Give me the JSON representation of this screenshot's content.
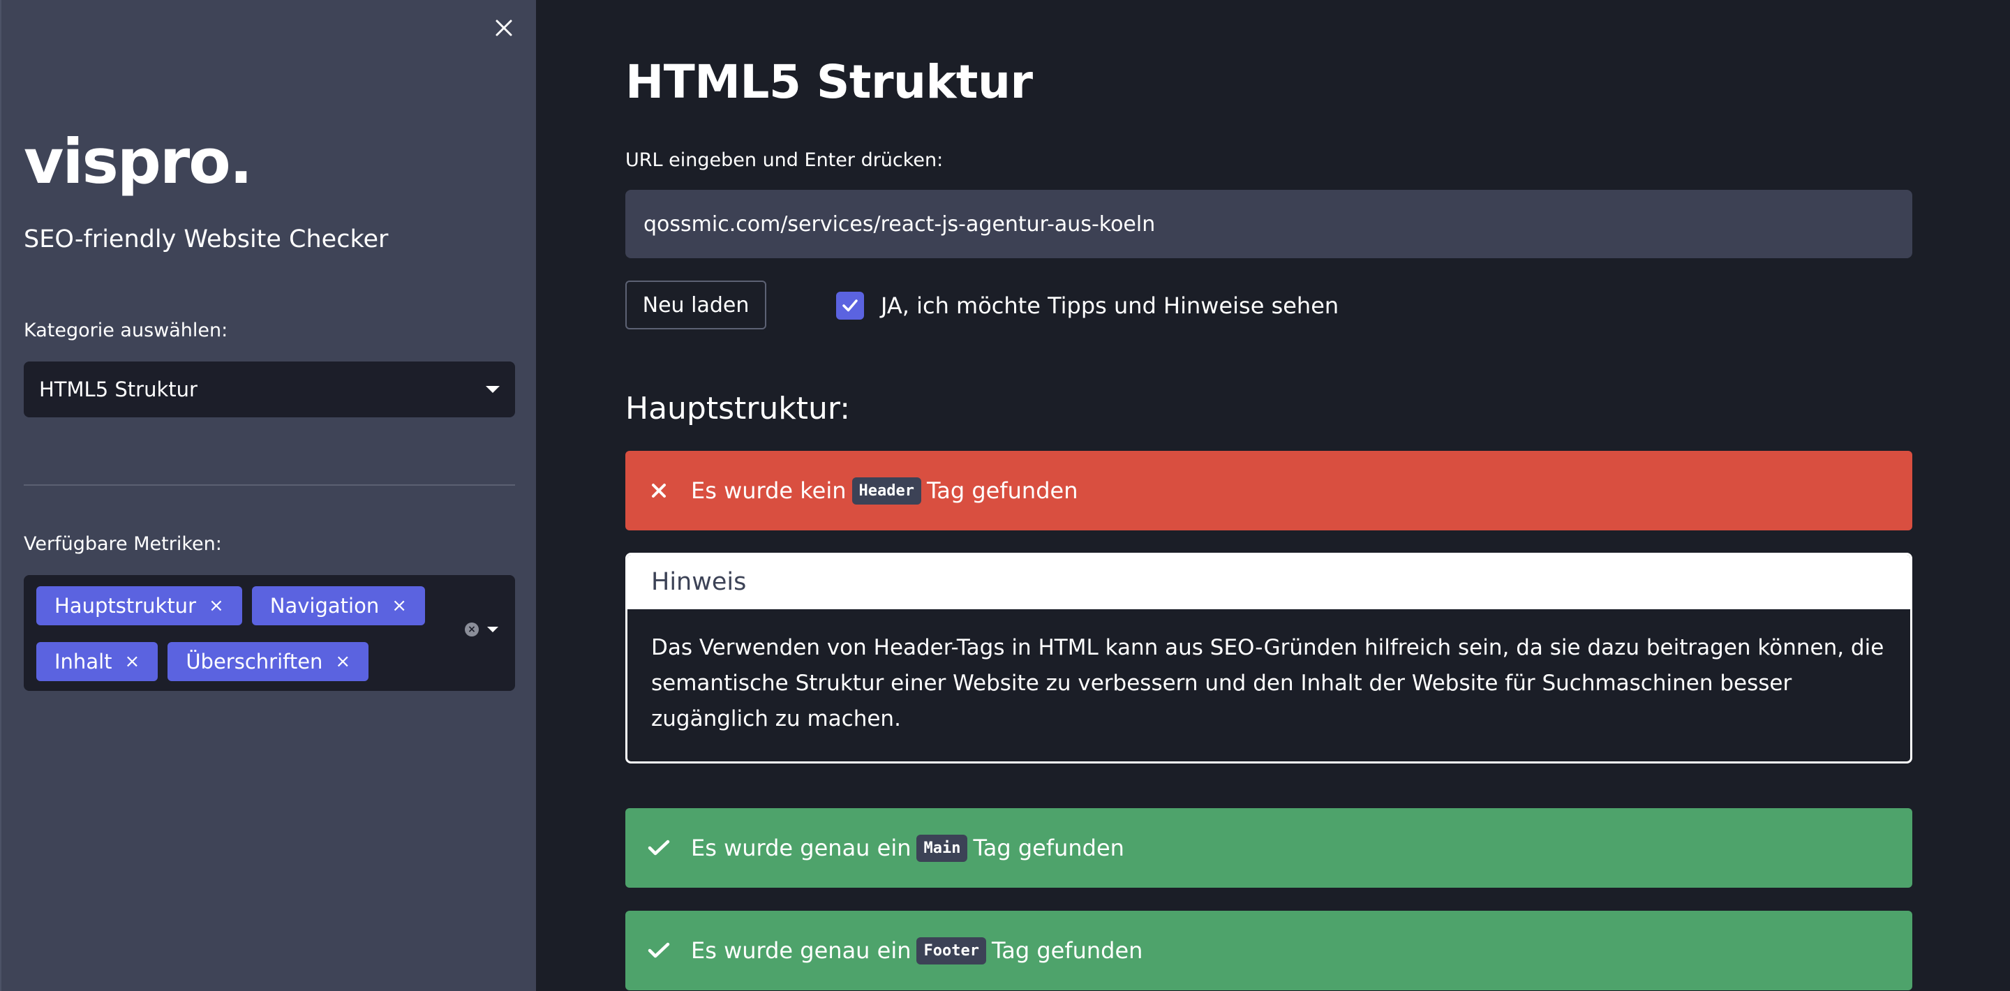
{
  "sidebar": {
    "close_icon": "close-icon",
    "brand": "vispro.",
    "tagline": "SEO-friendly Website Checker",
    "category_label": "Kategorie auswählen:",
    "category_value": "HTML5 Struktur",
    "metrics_label": "Verfügbare Metriken:",
    "metrics": [
      {
        "label": "Hauptstruktur"
      },
      {
        "label": "Navigation"
      },
      {
        "label": "Inhalt"
      },
      {
        "label": "Überschriften"
      }
    ],
    "chip_remove": "×"
  },
  "main": {
    "title": "HTML5 Struktur",
    "url_label": "URL eingeben und Enter drücken:",
    "url_value": "qossmic.com/services/react-js-agentur-aus-koeln",
    "reload_label": "Neu laden",
    "tips_label": "JA, ich möchte Tipps und Hinweise sehen",
    "tips_checked": true,
    "section_title": "Hauptstruktur:",
    "alerts": [
      {
        "status": "error",
        "pre": "Es wurde kein",
        "tag": "Header",
        "post": "Tag gefunden"
      },
      {
        "status": "success",
        "pre": "Es wurde genau ein",
        "tag": "Main",
        "post": "Tag gefunden"
      },
      {
        "status": "success",
        "pre": "Es wurde genau ein",
        "tag": "Footer",
        "post": "Tag gefunden"
      }
    ],
    "hint": {
      "title": "Hinweis",
      "text": "Das Verwenden von Header-Tags in HTML kann aus SEO-Gründen hilfreich sein, da sie dazu beitragen können, die semantische Struktur einer Website zu verbessern und den Inhalt der Website für Suchmaschinen besser zugänglich zu machen."
    }
  },
  "colors": {
    "sidebar_bg": "#3f4457",
    "main_bg": "#1b1e27",
    "accent": "#5b63e0",
    "error": "#d94f40",
    "success": "#4ea36b"
  }
}
